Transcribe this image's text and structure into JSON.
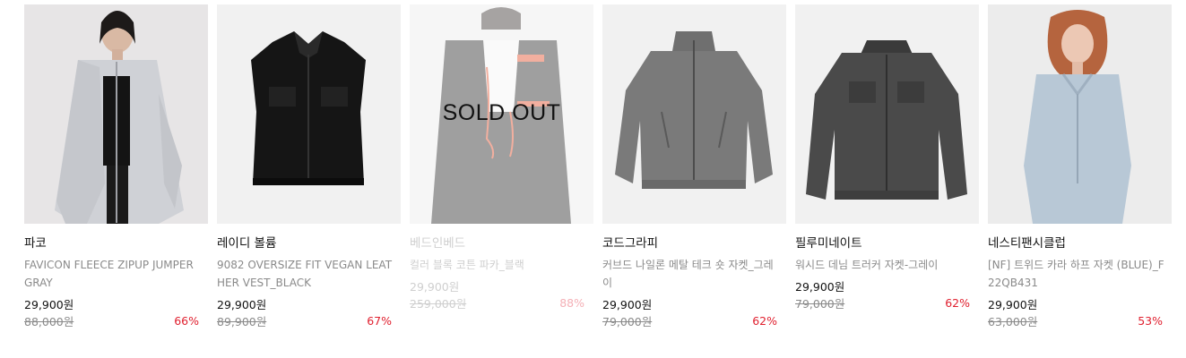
{
  "products": [
    {
      "brand": "파코",
      "name": "FAVICON FLEECE ZIPUP JUMPER GRAY",
      "price": "29,900원",
      "original_price": "88,000원",
      "discount": "66%"
    },
    {
      "brand": "레이디 볼륨",
      "name": "9082 OVERSIZE FIT VEGAN LEATHER VEST_BLACK",
      "price": "29,900원",
      "original_price": "89,900원",
      "discount": "67%"
    },
    {
      "brand": "베드인베드",
      "name": "컬러 블록 코튼 파카_블랙",
      "price": "29,900원",
      "original_price": "259,000원",
      "discount": "88%",
      "status": "SOLD OUT"
    },
    {
      "brand": "코드그라피",
      "name": "커브드 나일론 메탈 테크 숏 자켓_그레이",
      "price": "29,900원",
      "original_price": "79,000원",
      "discount": "62%"
    },
    {
      "brand": "필루미네이트",
      "name": "워시드 데님 트러커 자켓-그레이",
      "price": "29,900원",
      "original_price": "79,000원",
      "discount": "62%"
    },
    {
      "brand": "네스티팬시클럽",
      "name": "[NF] 트위드 카라 하프 자켓 (BLUE)_F22QB431",
      "price": "29,900원",
      "original_price": "63,000원",
      "discount": "53%"
    }
  ],
  "colors": {
    "discount": "#e0202f",
    "brand_text": "#111111",
    "muted_text": "#8a8a8a"
  }
}
